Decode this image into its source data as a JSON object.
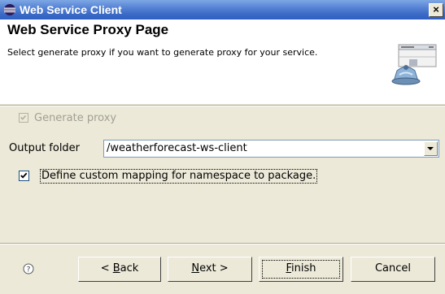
{
  "window": {
    "title": "Web Service Client",
    "close_glyph": "×"
  },
  "header": {
    "title": "Web Service Proxy Page",
    "description": "Select generate proxy if you want to generate proxy for your service."
  },
  "form": {
    "generate_proxy": {
      "label": "Generate proxy",
      "checked": true,
      "enabled": false
    },
    "output_folder": {
      "label": "Output folder",
      "value": "/weatherforecast-ws-client"
    },
    "custom_mapping": {
      "label": "Define custom mapping for namespace to package.",
      "checked": true
    }
  },
  "buttons": {
    "back": {
      "pre": "< ",
      "mnemonic": "B",
      "post": "ack"
    },
    "next": {
      "mnemonic": "N",
      "post": "ext >"
    },
    "finish": {
      "mnemonic": "F",
      "post": "inish"
    },
    "cancel": "Cancel"
  },
  "icons": {
    "app": "eclipse-icon",
    "help": "question-mark-icon",
    "wizard": "web-service-wizard-icon",
    "check": "check-icon"
  },
  "colors": {
    "titlebar": "#2f5fbf",
    "dialog_bg": "#ece9d8",
    "disabled_text": "#a19f94"
  }
}
